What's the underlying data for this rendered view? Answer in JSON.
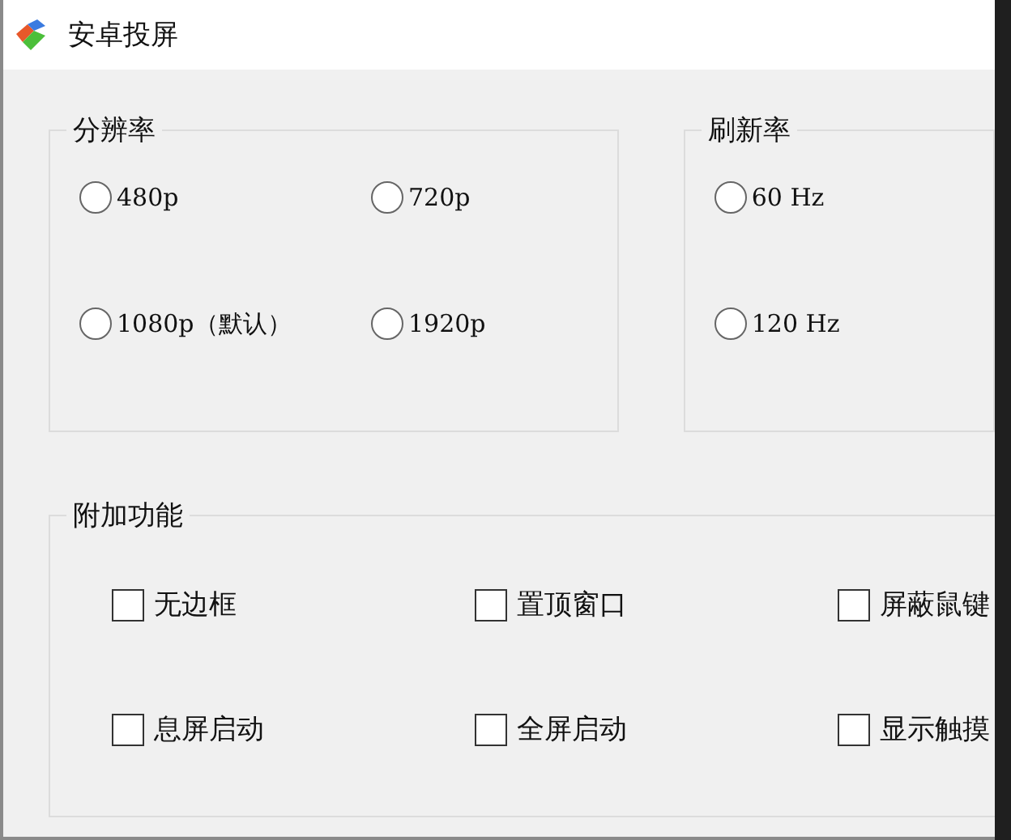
{
  "window": {
    "title": "安卓投屏"
  },
  "resolution": {
    "label": "分辨率",
    "options": [
      {
        "label": "480p",
        "selected": false
      },
      {
        "label": "720p",
        "selected": false
      },
      {
        "label": "1080p（默认）",
        "selected": false
      },
      {
        "label": "1920p",
        "selected": false
      }
    ]
  },
  "refresh_rate": {
    "label": "刷新率",
    "options": [
      {
        "label": "60 Hz",
        "selected": false
      },
      {
        "label": "120 Hz",
        "selected": false
      }
    ]
  },
  "extras": {
    "label": "附加功能",
    "options": [
      {
        "label": "无边框",
        "checked": false
      },
      {
        "label": "置顶窗口",
        "checked": false
      },
      {
        "label": "屏蔽鼠键",
        "checked": false
      },
      {
        "label": "息屏启动",
        "checked": false
      },
      {
        "label": "全屏启动",
        "checked": false
      },
      {
        "label": "显示触摸",
        "checked": false
      }
    ]
  }
}
